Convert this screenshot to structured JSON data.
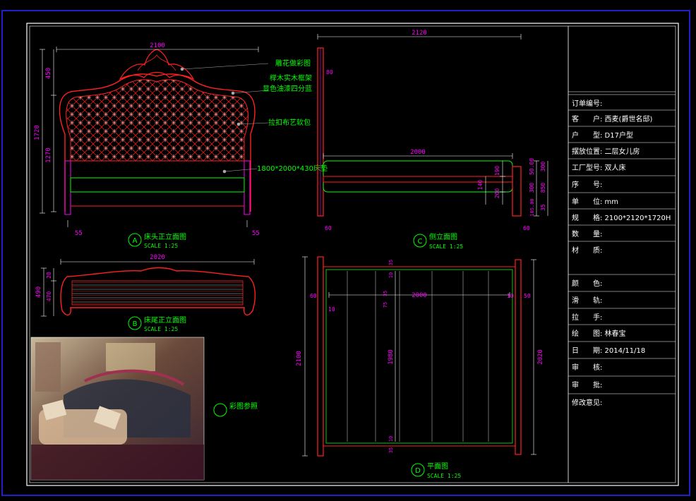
{
  "colors": {
    "background": "#000000",
    "frame": "#2020c8",
    "border": "#ffffff",
    "furniture": "#ff2020",
    "fabric": "#ff00ff",
    "mattress": "#00ff00",
    "annotation": "#00ff00",
    "dimension": "#ffffff"
  },
  "views": {
    "a": {
      "marker": "A",
      "title": "床头正立面图",
      "scale": "SCALE 1:25",
      "dims": {
        "width": "2100",
        "crown": "450",
        "total_h": "1720",
        "panel_h": "1270",
        "post_l": "55",
        "post_r": "55"
      },
      "callouts": [
        "雕花做彩图",
        "榉木实木框架",
        "显色油漆四分蓝",
        "拉扣布艺软包",
        "1800*2000*430床垫"
      ]
    },
    "b": {
      "marker": "B",
      "title": "床尾正立面图",
      "scale": "SCALE 1:25",
      "dims": {
        "width": "2020",
        "h_total": "490",
        "h_top": "20",
        "h_panel": "470"
      }
    },
    "c": {
      "marker": "C",
      "title": "侧立面图",
      "scale": "SCALE 1:25",
      "dims": {
        "total": "2120",
        "length": "2000",
        "head": "80",
        "foot_post": "60",
        "head_post": "60",
        "r1": "190",
        "r2": "140",
        "r3": "200",
        "r4": "50.00",
        "r5": "300",
        "r6": "850",
        "r7": "105.00",
        "r8": "300",
        "r9": "35"
      }
    },
    "d": {
      "marker": "D",
      "title": "平面图",
      "scale": "SCALE 1:25",
      "dims": {
        "total": "2100",
        "inner": "2000",
        "left_post": "60",
        "right_post": "50",
        "gap_l": "10",
        "gap_r": "10",
        "slat_len": "1980",
        "side": "2020",
        "s1": "35",
        "s2": "10",
        "s3": "35",
        "s4": "75",
        "s5": "35",
        "s6": "10"
      }
    },
    "photo": {
      "label": "彩图参照"
    }
  },
  "title_block": {
    "rows": [
      {
        "label": "订单编号:",
        "value": ""
      },
      {
        "label": "客　　户:",
        "value": "西麦(爵世名邸)"
      },
      {
        "label": "户　　型:",
        "value": "D17户型"
      },
      {
        "label": "摆放位置:",
        "value": "二层女儿房"
      },
      {
        "label": "工厂型号:",
        "value": "双人床"
      },
      {
        "label": "序　　号:",
        "value": ""
      },
      {
        "label": "单　　位:",
        "value": "mm"
      },
      {
        "label": "规　　格:",
        "value": "2100*2120*1720H"
      },
      {
        "label": "数　　量:",
        "value": ""
      },
      {
        "label": "材　　质:",
        "value": ""
      },
      {
        "label": "颜　　色:",
        "value": ""
      },
      {
        "label": "滑　　轨:",
        "value": ""
      },
      {
        "label": "拉　　手:",
        "value": ""
      },
      {
        "label": "绘　　图:",
        "value": "林春宝"
      },
      {
        "label": "日　　期:",
        "value": "2014/11/18"
      },
      {
        "label": "审　　核:",
        "value": ""
      },
      {
        "label": "审　　批:",
        "value": ""
      },
      {
        "label": "修改意见:",
        "value": ""
      }
    ]
  }
}
